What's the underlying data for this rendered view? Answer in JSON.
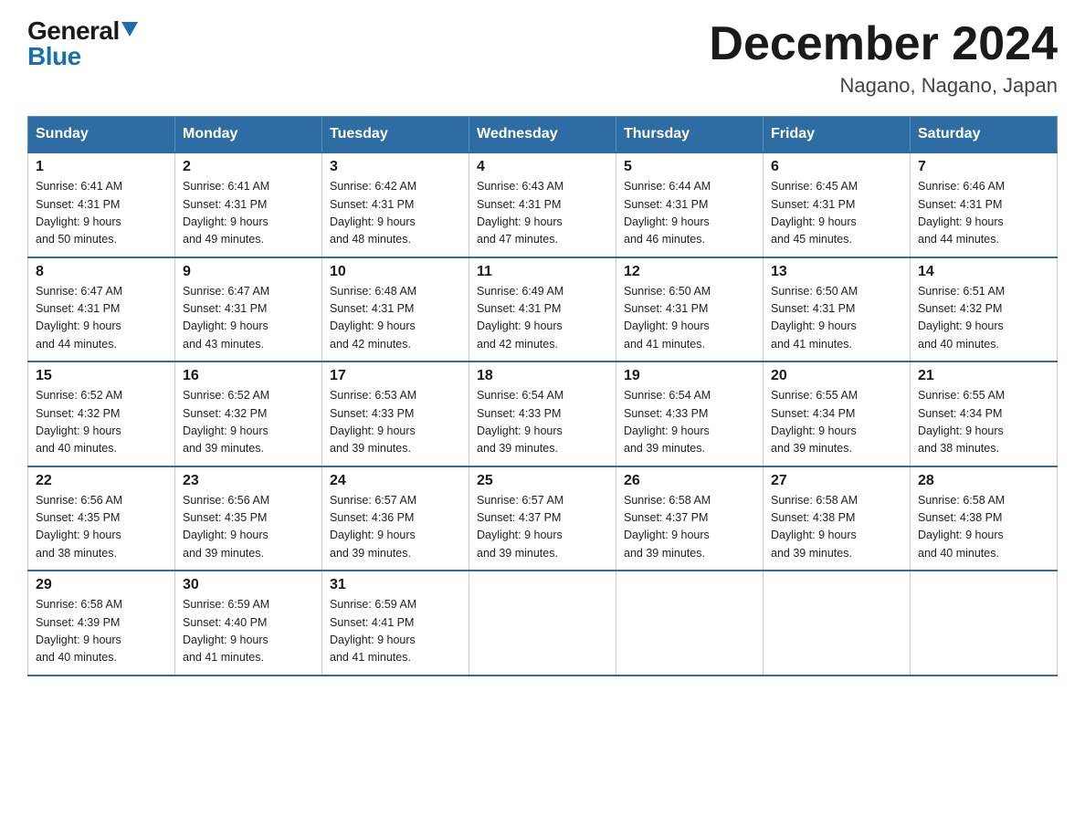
{
  "logo": {
    "general": "General",
    "blue": "Blue"
  },
  "title": "December 2024",
  "location": "Nagano, Nagano, Japan",
  "days_header": [
    "Sunday",
    "Monday",
    "Tuesday",
    "Wednesday",
    "Thursday",
    "Friday",
    "Saturday"
  ],
  "weeks": [
    [
      {
        "day": "1",
        "sunrise": "6:41 AM",
        "sunset": "4:31 PM",
        "daylight": "9 hours and 50 minutes."
      },
      {
        "day": "2",
        "sunrise": "6:41 AM",
        "sunset": "4:31 PM",
        "daylight": "9 hours and 49 minutes."
      },
      {
        "day": "3",
        "sunrise": "6:42 AM",
        "sunset": "4:31 PM",
        "daylight": "9 hours and 48 minutes."
      },
      {
        "day": "4",
        "sunrise": "6:43 AM",
        "sunset": "4:31 PM",
        "daylight": "9 hours and 47 minutes."
      },
      {
        "day": "5",
        "sunrise": "6:44 AM",
        "sunset": "4:31 PM",
        "daylight": "9 hours and 46 minutes."
      },
      {
        "day": "6",
        "sunrise": "6:45 AM",
        "sunset": "4:31 PM",
        "daylight": "9 hours and 45 minutes."
      },
      {
        "day": "7",
        "sunrise": "6:46 AM",
        "sunset": "4:31 PM",
        "daylight": "9 hours and 44 minutes."
      }
    ],
    [
      {
        "day": "8",
        "sunrise": "6:47 AM",
        "sunset": "4:31 PM",
        "daylight": "9 hours and 44 minutes."
      },
      {
        "day": "9",
        "sunrise": "6:47 AM",
        "sunset": "4:31 PM",
        "daylight": "9 hours and 43 minutes."
      },
      {
        "day": "10",
        "sunrise": "6:48 AM",
        "sunset": "4:31 PM",
        "daylight": "9 hours and 42 minutes."
      },
      {
        "day": "11",
        "sunrise": "6:49 AM",
        "sunset": "4:31 PM",
        "daylight": "9 hours and 42 minutes."
      },
      {
        "day": "12",
        "sunrise": "6:50 AM",
        "sunset": "4:31 PM",
        "daylight": "9 hours and 41 minutes."
      },
      {
        "day": "13",
        "sunrise": "6:50 AM",
        "sunset": "4:31 PM",
        "daylight": "9 hours and 41 minutes."
      },
      {
        "day": "14",
        "sunrise": "6:51 AM",
        "sunset": "4:32 PM",
        "daylight": "9 hours and 40 minutes."
      }
    ],
    [
      {
        "day": "15",
        "sunrise": "6:52 AM",
        "sunset": "4:32 PM",
        "daylight": "9 hours and 40 minutes."
      },
      {
        "day": "16",
        "sunrise": "6:52 AM",
        "sunset": "4:32 PM",
        "daylight": "9 hours and 39 minutes."
      },
      {
        "day": "17",
        "sunrise": "6:53 AM",
        "sunset": "4:33 PM",
        "daylight": "9 hours and 39 minutes."
      },
      {
        "day": "18",
        "sunrise": "6:54 AM",
        "sunset": "4:33 PM",
        "daylight": "9 hours and 39 minutes."
      },
      {
        "day": "19",
        "sunrise": "6:54 AM",
        "sunset": "4:33 PM",
        "daylight": "9 hours and 39 minutes."
      },
      {
        "day": "20",
        "sunrise": "6:55 AM",
        "sunset": "4:34 PM",
        "daylight": "9 hours and 39 minutes."
      },
      {
        "day": "21",
        "sunrise": "6:55 AM",
        "sunset": "4:34 PM",
        "daylight": "9 hours and 38 minutes."
      }
    ],
    [
      {
        "day": "22",
        "sunrise": "6:56 AM",
        "sunset": "4:35 PM",
        "daylight": "9 hours and 38 minutes."
      },
      {
        "day": "23",
        "sunrise": "6:56 AM",
        "sunset": "4:35 PM",
        "daylight": "9 hours and 39 minutes."
      },
      {
        "day": "24",
        "sunrise": "6:57 AM",
        "sunset": "4:36 PM",
        "daylight": "9 hours and 39 minutes."
      },
      {
        "day": "25",
        "sunrise": "6:57 AM",
        "sunset": "4:37 PM",
        "daylight": "9 hours and 39 minutes."
      },
      {
        "day": "26",
        "sunrise": "6:58 AM",
        "sunset": "4:37 PM",
        "daylight": "9 hours and 39 minutes."
      },
      {
        "day": "27",
        "sunrise": "6:58 AM",
        "sunset": "4:38 PM",
        "daylight": "9 hours and 39 minutes."
      },
      {
        "day": "28",
        "sunrise": "6:58 AM",
        "sunset": "4:38 PM",
        "daylight": "9 hours and 40 minutes."
      }
    ],
    [
      {
        "day": "29",
        "sunrise": "6:58 AM",
        "sunset": "4:39 PM",
        "daylight": "9 hours and 40 minutes."
      },
      {
        "day": "30",
        "sunrise": "6:59 AM",
        "sunset": "4:40 PM",
        "daylight": "9 hours and 41 minutes."
      },
      {
        "day": "31",
        "sunrise": "6:59 AM",
        "sunset": "4:41 PM",
        "daylight": "9 hours and 41 minutes."
      },
      null,
      null,
      null,
      null
    ]
  ],
  "labels": {
    "sunrise": "Sunrise:",
    "sunset": "Sunset:",
    "daylight": "Daylight:"
  }
}
